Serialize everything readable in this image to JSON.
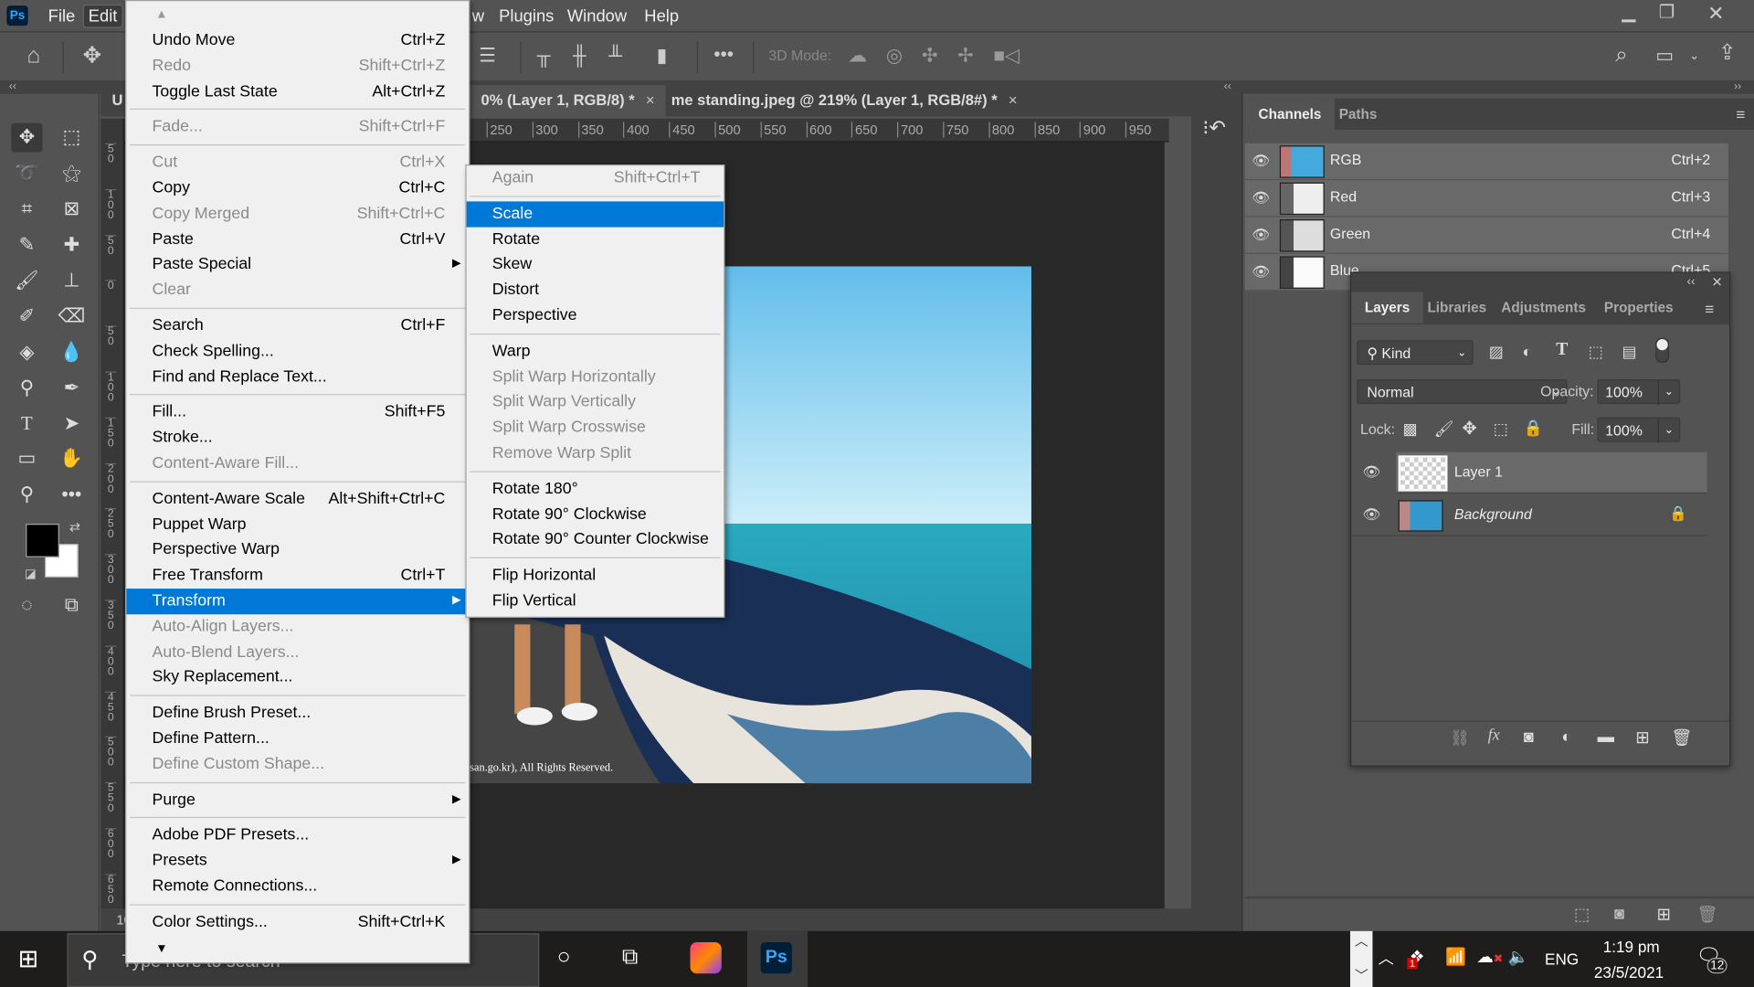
{
  "app": {
    "logo": "Ps"
  },
  "menubar": {
    "items": [
      "File",
      "Edit"
    ],
    "items_right": [
      "w",
      "Plugins",
      "Window",
      "Help"
    ],
    "active": "Edit"
  },
  "window_controls": [
    "minimize-icon",
    "restore-icon",
    "close-icon"
  ],
  "options_bar": {
    "mode_label": "3D Mode:"
  },
  "tabs": [
    {
      "label": "U",
      "active": false
    },
    {
      "label": "0% (Layer 1, RGB/8) *",
      "close": "×",
      "active": true
    },
    {
      "label": "me standing.jpeg @ 219% (Layer 1, RGB/8#) *",
      "close": "×",
      "active": false
    }
  ],
  "ruler": {
    "h": [
      "250",
      "300",
      "350",
      "400",
      "450",
      "500",
      "550",
      "600",
      "650",
      "700",
      "750",
      "800",
      "850",
      "900",
      "950"
    ],
    "v": [
      "50",
      "100",
      "50",
      "0",
      "50",
      "100",
      "150",
      "200",
      "250",
      "300",
      "350",
      "400",
      "450",
      "500",
      "550",
      "600",
      "650"
    ]
  },
  "status": {
    "zoom": "10"
  },
  "canvas": {
    "copyright": "san.go.kr), All Rights Reserved."
  },
  "edit_menu": [
    {
      "type": "scroll-up"
    },
    {
      "label": "Undo Move",
      "shortcut": "Ctrl+Z"
    },
    {
      "label": "Redo",
      "shortcut": "Shift+Ctrl+Z",
      "disabled": true
    },
    {
      "label": "Toggle Last State",
      "shortcut": "Alt+Ctrl+Z"
    },
    {
      "type": "sep"
    },
    {
      "label": "Fade...",
      "shortcut": "Shift+Ctrl+F",
      "disabled": true
    },
    {
      "type": "sep"
    },
    {
      "label": "Cut",
      "shortcut": "Ctrl+X",
      "disabled": true
    },
    {
      "label": "Copy",
      "shortcut": "Ctrl+C"
    },
    {
      "label": "Copy Merged",
      "shortcut": "Shift+Ctrl+C",
      "disabled": true
    },
    {
      "label": "Paste",
      "shortcut": "Ctrl+V"
    },
    {
      "label": "Paste Special",
      "submenu": true
    },
    {
      "label": "Clear",
      "disabled": true
    },
    {
      "type": "sep"
    },
    {
      "label": "Search",
      "shortcut": "Ctrl+F"
    },
    {
      "label": "Check Spelling..."
    },
    {
      "label": "Find and Replace Text..."
    },
    {
      "type": "sep"
    },
    {
      "label": "Fill...",
      "shortcut": "Shift+F5"
    },
    {
      "label": "Stroke..."
    },
    {
      "label": "Content-Aware Fill...",
      "disabled": true
    },
    {
      "type": "sep"
    },
    {
      "label": "Content-Aware Scale",
      "shortcut": "Alt+Shift+Ctrl+C"
    },
    {
      "label": "Puppet Warp"
    },
    {
      "label": "Perspective Warp"
    },
    {
      "label": "Free Transform",
      "shortcut": "Ctrl+T"
    },
    {
      "label": "Transform",
      "submenu": true,
      "highlighted": true
    },
    {
      "label": "Auto-Align Layers...",
      "disabled": true
    },
    {
      "label": "Auto-Blend Layers...",
      "disabled": true
    },
    {
      "label": "Sky Replacement..."
    },
    {
      "type": "sep"
    },
    {
      "label": "Define Brush Preset..."
    },
    {
      "label": "Define Pattern..."
    },
    {
      "label": "Define Custom Shape...",
      "disabled": true
    },
    {
      "type": "sep"
    },
    {
      "label": "Purge",
      "submenu": true
    },
    {
      "type": "sep"
    },
    {
      "label": "Adobe PDF Presets..."
    },
    {
      "label": "Presets",
      "submenu": true
    },
    {
      "label": "Remote Connections..."
    },
    {
      "type": "sep"
    },
    {
      "label": "Color Settings...",
      "shortcut": "Shift+Ctrl+K"
    },
    {
      "type": "scroll-down"
    }
  ],
  "transform_menu": [
    {
      "label": "Again",
      "shortcut": "Shift+Ctrl+T",
      "disabled": true
    },
    {
      "type": "sep"
    },
    {
      "label": "Scale",
      "highlighted": true
    },
    {
      "label": "Rotate"
    },
    {
      "label": "Skew"
    },
    {
      "label": "Distort"
    },
    {
      "label": "Perspective"
    },
    {
      "type": "sep"
    },
    {
      "label": "Warp"
    },
    {
      "label": "Split Warp Horizontally",
      "disabled": true
    },
    {
      "label": "Split Warp Vertically",
      "disabled": true
    },
    {
      "label": "Split Warp Crosswise",
      "disabled": true
    },
    {
      "label": "Remove Warp Split",
      "disabled": true
    },
    {
      "type": "sep"
    },
    {
      "label": "Rotate 180°"
    },
    {
      "label": "Rotate 90° Clockwise"
    },
    {
      "label": "Rotate 90° Counter Clockwise"
    },
    {
      "type": "sep"
    },
    {
      "label": "Flip Horizontal"
    },
    {
      "label": "Flip Vertical"
    }
  ],
  "channels_panel": {
    "tabs": [
      "Channels",
      "Paths"
    ],
    "active": "Channels",
    "rows": [
      {
        "name": "RGB",
        "shortcut": "Ctrl+2"
      },
      {
        "name": "Red",
        "shortcut": "Ctrl+3"
      },
      {
        "name": "Green",
        "shortcut": "Ctrl+4"
      },
      {
        "name": "Blue",
        "shortcut": "Ctrl+5"
      }
    ]
  },
  "layers_panel": {
    "tabs": [
      "Layers",
      "Libraries",
      "Adjustments",
      "Properties"
    ],
    "active": "Layers",
    "filter": "Kind",
    "blend_mode": "Normal",
    "opacity_label": "Opacity:",
    "opacity": "100%",
    "lock_label": "Lock:",
    "fill_label": "Fill:",
    "fill": "100%",
    "layers": [
      {
        "name": "Layer 1",
        "selected": true,
        "visible": true
      },
      {
        "name": "Background",
        "locked": true,
        "visible": true
      }
    ]
  },
  "taskbar": {
    "search_placeholder": "Type here to search",
    "language": "ENG",
    "time": "1:19 pm",
    "date": "23/5/2021",
    "notifications": "12",
    "dropbox_badge": "1"
  },
  "colors": {
    "accent": "#0078d7",
    "panel": "#535353",
    "canvas": "#282828",
    "menu": "#f0f0f0"
  }
}
